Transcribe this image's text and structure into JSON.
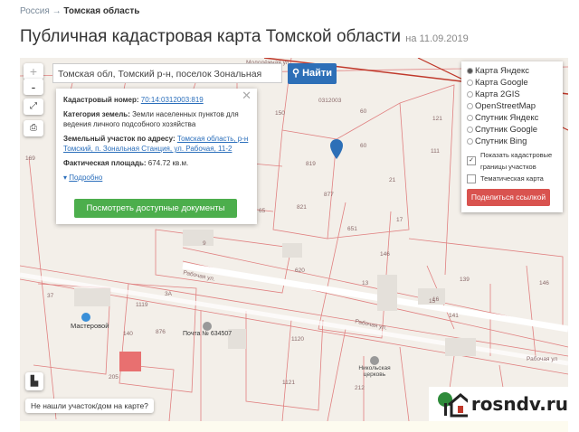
{
  "breadcrumb": {
    "parent": "Россия",
    "separator": "→",
    "current": "Томская область"
  },
  "title": {
    "main": "Публичная кадастровая карта Томской области",
    "date": "на 11.09.2019"
  },
  "map": {
    "search_value": "Томская обл, Томский р-н, поселок Зональная Станция",
    "search_button": "Найти",
    "zoom_in": "+",
    "zoom_out": "-",
    "labels": [
      "Молодёжная ул",
      "0312003",
      "150",
      "60",
      "121",
      "111",
      "819",
      "821",
      "877",
      "65",
      "21",
      "60",
      "17",
      "651",
      "146",
      "9",
      "620",
      "37",
      "3А",
      "1119",
      "876",
      "140",
      "13",
      "15",
      "16",
      "139",
      "141",
      "146",
      "1120",
      "1121",
      "212",
      "205",
      "169",
      "Рабочая ул.",
      "Рабочая ул.",
      "Рабочая ул"
    ],
    "poi": {
      "masterovoy": "Мастеровой",
      "post": "Почта № 634507",
      "church": "Никольская церковь"
    },
    "not_found": "Не нашли участок/дом на карте?"
  },
  "popup": {
    "cad_label": "Кадастровый номер:",
    "cad_value": "70:14:0312003:819",
    "cat_label": "Категория земель:",
    "cat_value": "Земли населенных пунктов для ведения личного подсобного хозяйства",
    "addr_label": "Земельный участок по адресу:",
    "addr_value": "Томская область, р-н Томский, п. Зональная Станция, ул. Рабочая, 11-2",
    "area_label": "Фактическая площадь:",
    "area_value": "674.72 кв.м.",
    "more": "Подробно",
    "docs_button": "Посмотреть доступные документы"
  },
  "layers": {
    "options": [
      "Карта Яндекс",
      "Карта Google",
      "Карта 2GIS",
      "OpenStreetMap",
      "Спутник Яндекс",
      "Спутник Google",
      "Спутник Bing"
    ],
    "selected": "Карта Яндекс",
    "show_borders": "Показать кадастровые границы участков",
    "thematic": "Тематическая карта",
    "share": "Поделиться ссылкой"
  },
  "logo": {
    "text": "rosndv.ru"
  },
  "colors": {
    "primary": "#2d6fb7",
    "success": "#4cae4c",
    "danger": "#d9534f",
    "parcel": "#d9534f"
  }
}
